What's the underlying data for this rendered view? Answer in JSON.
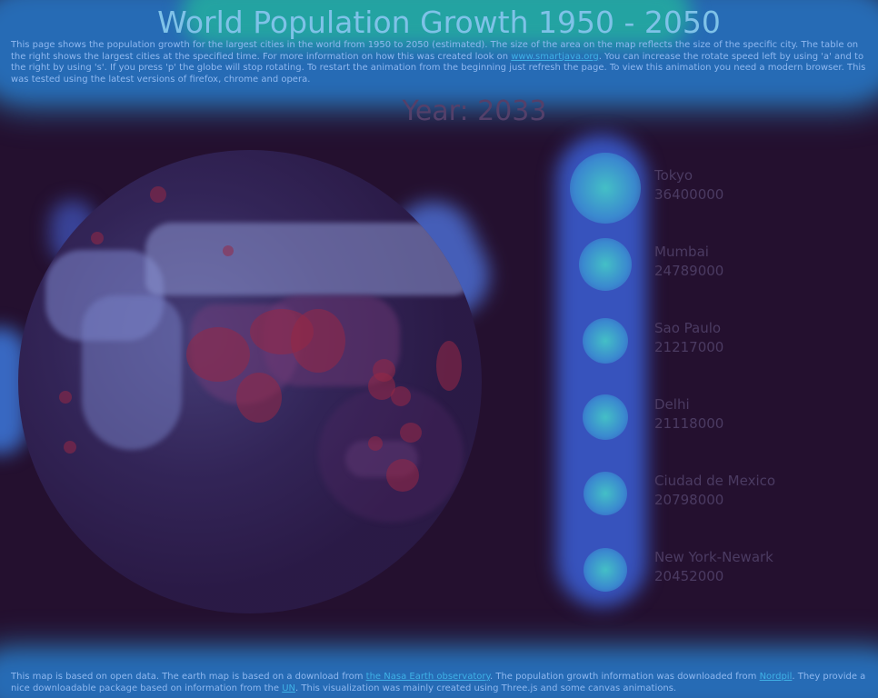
{
  "page": {
    "title": "World Population Growth 1950 - 2050",
    "intro": {
      "part1": "This page shows the population growth for the largest cities in the world from 1950 to 2050 (estimated). The size of the area on the map reflects the size of the specific city. The table on the right shows the largest cities at the specified time. For more information on how this was created look on ",
      "link_text": "www.smartjava.org",
      "part2": ". You can increase the rotate speed left by using 'a' and to the right by using 's'. If you press 'p' the globe will stop rotating. To restart the animation from the beginning just refresh the page. To view this animation you need a modern browser. This was tested using the latest versions of firefox, chrome and opera."
    },
    "year_label": "Year: 2033",
    "cities": [
      {
        "name": "Tokyo",
        "population": "36400000"
      },
      {
        "name": "Mumbai",
        "population": "24789000"
      },
      {
        "name": "Sao Paulo",
        "population": "21217000"
      },
      {
        "name": "Delhi",
        "population": "21118000"
      },
      {
        "name": "Ciudad de Mexico",
        "population": "20798000"
      },
      {
        "name": "New York-Newark",
        "population": "20452000"
      }
    ],
    "footer": {
      "part1": "This map is based on open data. The earth map is based on a download from ",
      "link1": "the Nasa Earth observatory",
      "part2": ". The population growth information was downloaded from ",
      "link2": "Nordpil",
      "part3": ". They provide a nice downloadable package based on information from the ",
      "link3": "UN",
      "part4": ". This visualization was mainly created using Three.js and some canvas animations."
    }
  },
  "colors": {
    "background": "#24102f",
    "title": "#7fc2e8",
    "link": "#3fb1e6",
    "city_text": "#4b3b62",
    "year_text": "#54406a"
  },
  "icons": {
    "globe": "earth-globe-icon"
  }
}
